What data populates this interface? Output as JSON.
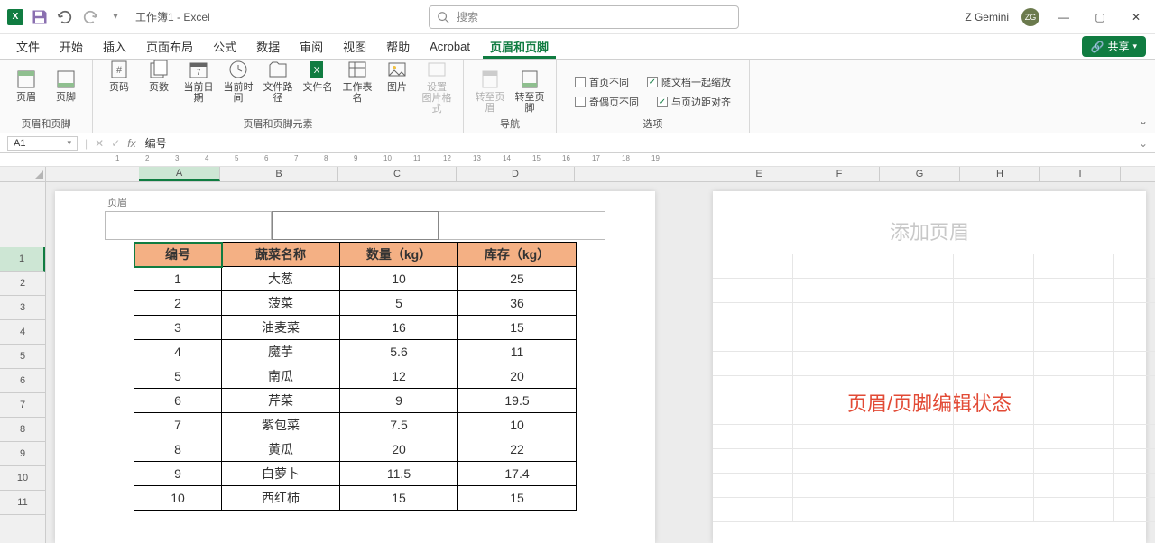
{
  "titlebar": {
    "title": "工作簿1 - Excel",
    "search_placeholder": "搜索",
    "user_name": "Z Gemini",
    "avatar": "ZG"
  },
  "tabs": [
    "文件",
    "开始",
    "插入",
    "页面布局",
    "公式",
    "数据",
    "审阅",
    "视图",
    "帮助",
    "Acrobat",
    "页眉和页脚"
  ],
  "active_tab": "页眉和页脚",
  "share_label": "共享",
  "ribbon": {
    "group1": {
      "label": "页眉和页脚",
      "buttons": [
        "页眉",
        "页脚"
      ]
    },
    "group2": {
      "label": "页眉和页脚元素",
      "buttons": [
        "页码",
        "页数",
        "当前日期",
        "当前时间",
        "文件路径",
        "文件名",
        "工作表名",
        "图片",
        "设置\n图片格式"
      ]
    },
    "group3": {
      "label": "导航",
      "buttons": [
        "转至页眉",
        "转至页脚"
      ]
    },
    "group4": {
      "label": "选项",
      "opts": [
        {
          "label": "首页不同",
          "checked": false
        },
        {
          "label": "随文档一起缩放",
          "checked": true
        },
        {
          "label": "奇偶页不同",
          "checked": false
        },
        {
          "label": "与页边距对齐",
          "checked": true
        }
      ]
    }
  },
  "formula_bar": {
    "cell": "A1",
    "value": "编号"
  },
  "columns": [
    "A",
    "B",
    "C",
    "D",
    "E",
    "F",
    "G",
    "H",
    "I"
  ],
  "selected_col": "A",
  "selected_row": 1,
  "header_label": "页眉",
  "add_header_text": "添加页眉",
  "overlay_text": "页眉/页脚编辑状态",
  "table": {
    "headers": [
      "编号",
      "蔬菜名称",
      "数量（kg）",
      "库存（kg）"
    ],
    "rows": [
      [
        "1",
        "大葱",
        "10",
        "25"
      ],
      [
        "2",
        "菠菜",
        "5",
        "36"
      ],
      [
        "3",
        "油麦菜",
        "16",
        "15"
      ],
      [
        "4",
        "魔芋",
        "5.6",
        "11"
      ],
      [
        "5",
        "南瓜",
        "12",
        "20"
      ],
      [
        "6",
        "芹菜",
        "9",
        "19.5"
      ],
      [
        "7",
        "紫包菜",
        "7.5",
        "10"
      ],
      [
        "8",
        "黄瓜",
        "20",
        "22"
      ],
      [
        "9",
        "白萝卜",
        "11.5",
        "17.4"
      ],
      [
        "10",
        "西红柿",
        "15",
        "15"
      ]
    ]
  },
  "chart_data": {
    "type": "table",
    "title": "",
    "columns": [
      "编号",
      "蔬菜名称",
      "数量（kg）",
      "库存（kg）"
    ],
    "rows": [
      [
        1,
        "大葱",
        10,
        25
      ],
      [
        2,
        "菠菜",
        5,
        36
      ],
      [
        3,
        "油麦菜",
        16,
        15
      ],
      [
        4,
        "魔芋",
        5.6,
        11
      ],
      [
        5,
        "南瓜",
        12,
        20
      ],
      [
        6,
        "芹菜",
        9,
        19.5
      ],
      [
        7,
        "紫包菜",
        7.5,
        10
      ],
      [
        8,
        "黄瓜",
        20,
        22
      ],
      [
        9,
        "白萝卜",
        11.5,
        17.4
      ],
      [
        10,
        "西红柿",
        15,
        15
      ]
    ]
  }
}
